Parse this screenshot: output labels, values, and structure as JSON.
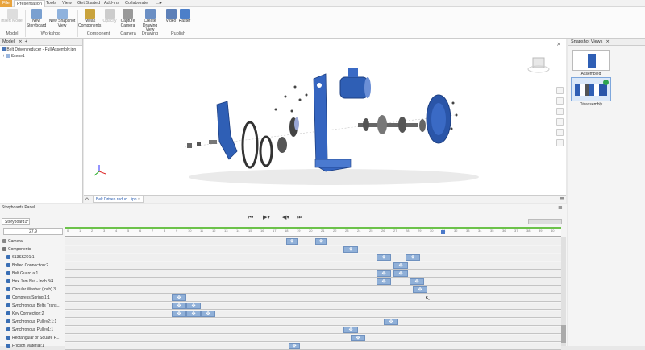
{
  "menu": [
    "File",
    "Presentation",
    "Tools",
    "View",
    "Get Started",
    "Add-Ins",
    "Collaborate"
  ],
  "ribbon": {
    "buttons": [
      "Insert Model",
      "New Storyboard",
      "New Snapshot View",
      "Tweak Components",
      "Opacity",
      "Capture Camera",
      "Create Drawing View",
      "Video",
      "Raster"
    ],
    "groups": [
      "Model",
      "Workshop",
      "Component",
      "Camera",
      "Drawing",
      "Publish"
    ]
  },
  "model_panel": {
    "tab": "Model",
    "tree": [
      "Belt Driven reducer - Full Assembly.ipn",
      "Scene1"
    ]
  },
  "viewport": {
    "doc_tab": "Belt Driven reduc....ipn"
  },
  "snapshot": {
    "tab": "Snapshot Views",
    "views": [
      "Assembled",
      "Disassembly"
    ]
  },
  "storyboard": {
    "panel_title": "Storyboards Panel",
    "tab": "Storyboard1",
    "time": "27.9",
    "ticks": [
      "0",
      "1",
      "2",
      "3",
      "4",
      "5",
      "6",
      "7",
      "8",
      "9",
      "10",
      "11",
      "12",
      "13",
      "14",
      "15",
      "16",
      "17",
      "18",
      "19",
      "20",
      "21",
      "22",
      "23",
      "24",
      "25",
      "26",
      "27",
      "28",
      "29",
      "30",
      "31",
      "32",
      "33",
      "34",
      "35",
      "36",
      "37",
      "38",
      "39",
      "40"
    ],
    "rows": [
      "Camera",
      "Components",
      "613SK201:1",
      "Bolted Connection:2",
      "Belt Guard a:1",
      "Hex Jam Nut - Inch 3/4 ...",
      "Circular Washer (Inch) 3...",
      "Compress Spring:1:1",
      "Synchronous Belts Trans...",
      "Key Connection:2",
      "Synchronous Pulley2:1:1",
      "Synchronous Pulley1:1",
      "Rectangular or Square P...",
      "Friction Material:1"
    ]
  }
}
